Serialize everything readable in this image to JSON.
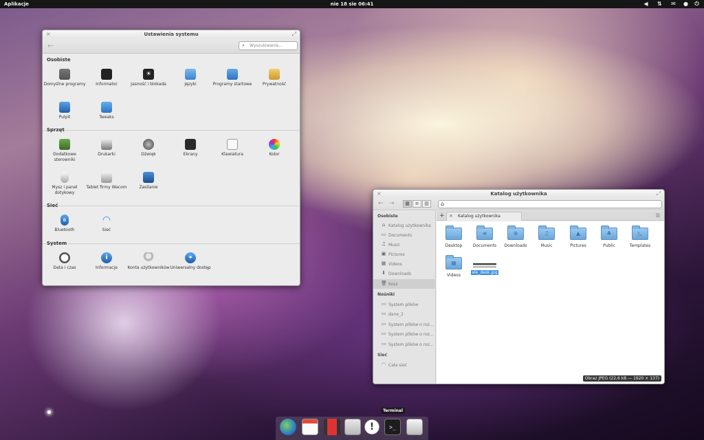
{
  "panel": {
    "apps": "Aplikacje",
    "clock": "nie 18 sie 06:41",
    "indicators": [
      "volume-icon",
      "network-icon",
      "mail-icon",
      "user-icon",
      "power-icon"
    ]
  },
  "settings": {
    "title": "Ustawienia systemu",
    "search_placeholder": "Wyszukiwanie...",
    "sections": [
      {
        "title": "Osobiste",
        "items": [
          {
            "label": "Domyślne programy",
            "icon": "default-apps-icon"
          },
          {
            "label": "Informator",
            "icon": "informator-icon"
          },
          {
            "label": "Jasność i blokada",
            "icon": "brightness-icon"
          },
          {
            "label": "Języki",
            "icon": "language-icon"
          },
          {
            "label": "Programy startowe",
            "icon": "startup-apps-icon"
          },
          {
            "label": "Prywatność",
            "icon": "privacy-lock-icon"
          },
          {
            "label": "Pulpit",
            "icon": "desktop-icon"
          },
          {
            "label": "Tweaks",
            "icon": "tweaks-icon"
          }
        ]
      },
      {
        "title": "Sprzęt",
        "items": [
          {
            "label": "Dodatkowe sterowniki",
            "icon": "drivers-icon"
          },
          {
            "label": "Drukarki",
            "icon": "printer-icon"
          },
          {
            "label": "Dźwięk",
            "icon": "sound-icon"
          },
          {
            "label": "Ekrany",
            "icon": "displays-icon"
          },
          {
            "label": "Klawiatura",
            "icon": "keyboard-icon"
          },
          {
            "label": "Kolor",
            "icon": "color-icon"
          },
          {
            "label": "Mysz i panel dotykowy",
            "icon": "mouse-icon"
          },
          {
            "label": "Tablet firmy Wacom",
            "icon": "tablet-icon"
          },
          {
            "label": "Zasilanie",
            "icon": "power-settings-icon"
          }
        ]
      },
      {
        "title": "Sieć",
        "items": [
          {
            "label": "Bluetooth",
            "icon": "bluetooth-icon"
          },
          {
            "label": "Sieć",
            "icon": "wifi-icon"
          }
        ]
      },
      {
        "title": "System",
        "items": [
          {
            "label": "Data i czas",
            "icon": "clock-icon"
          },
          {
            "label": "Informacje",
            "icon": "info-icon"
          },
          {
            "label": "Konta użytkowników",
            "icon": "user-accounts-icon"
          },
          {
            "label": "Uniwersalny dostęp",
            "icon": "accessibility-icon"
          }
        ]
      }
    ]
  },
  "files": {
    "title": "Katalog użytkownika",
    "tab_label": "Katalog użytkownika",
    "sidebar": [
      {
        "head": "Osobiste",
        "items": [
          {
            "label": "Katalog użytkownika",
            "icon": "⌂"
          },
          {
            "label": "Documents",
            "icon": "▭"
          },
          {
            "label": "Music",
            "icon": "♫"
          },
          {
            "label": "Pictures",
            "icon": "▣"
          },
          {
            "label": "Videos",
            "icon": "▦"
          },
          {
            "label": "Downloads",
            "icon": "⬇"
          },
          {
            "label": "Kosz",
            "icon": "🗑"
          }
        ]
      },
      {
        "head": "Nośniki",
        "items": [
          {
            "label": "System plików",
            "icon": "▭"
          },
          {
            "label": "dane_2",
            "icon": "▭"
          },
          {
            "label": "System plików o roz...",
            "icon": "▭"
          },
          {
            "label": "System plików o roz...",
            "icon": "▭"
          },
          {
            "label": "System plików o roz...",
            "icon": "▭"
          }
        ]
      },
      {
        "head": "Sieć",
        "items": [
          {
            "label": "Cała sieć",
            "icon": "◠"
          }
        ]
      }
    ],
    "items": [
      {
        "label": "Desktop",
        "glyph": ""
      },
      {
        "label": "Documents",
        "glyph": "≡"
      },
      {
        "label": "Downloads",
        "glyph": "⊕"
      },
      {
        "label": "Music",
        "glyph": "♫"
      },
      {
        "label": "Pictures",
        "glyph": "▲"
      },
      {
        "label": "Public",
        "glyph": "♣"
      },
      {
        "label": "Templates",
        "glyph": "◺"
      },
      {
        "label": "Videos",
        "glyph": "▦"
      },
      {
        "label": "ele_desk.jpg",
        "glyph": ""
      }
    ],
    "status": "Obraz JPEG (22,6 kB — 1920 × 137)"
  },
  "dock": {
    "tooltip": "Terminal",
    "items": [
      "browser-icon",
      "calendar-icon",
      "video-player-icon",
      "files-icon",
      "notifications-icon",
      "terminal-icon",
      "settings-switch-icon"
    ]
  }
}
